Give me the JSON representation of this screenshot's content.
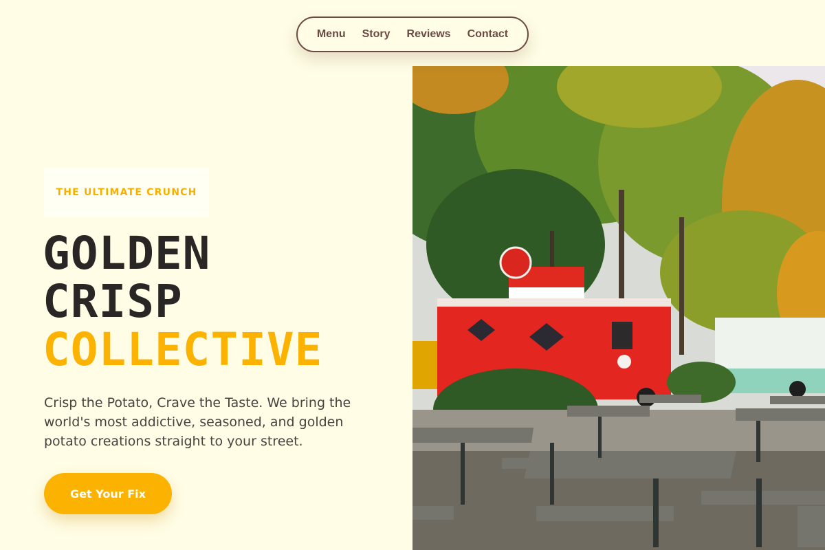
{
  "nav": {
    "links": [
      "Menu",
      "Story",
      "Reviews",
      "Contact"
    ]
  },
  "hero": {
    "eyebrow": "THE ULTIMATE CRUNCH",
    "headline": {
      "line1": "GOLDEN",
      "line2": "CRISP",
      "line3": "COLLECTIVE"
    },
    "subcopy": "Crisp the Potato, Crave the Taste. We bring the world's most addictive, seasoned, and golden potato creations straight to your street.",
    "cta_label": "Get Your Fix"
  },
  "colors": {
    "background": "#fffde6",
    "accent": "#fbb200",
    "nav_text": "#6b4a42",
    "headline_dark": "#2b2626"
  }
}
